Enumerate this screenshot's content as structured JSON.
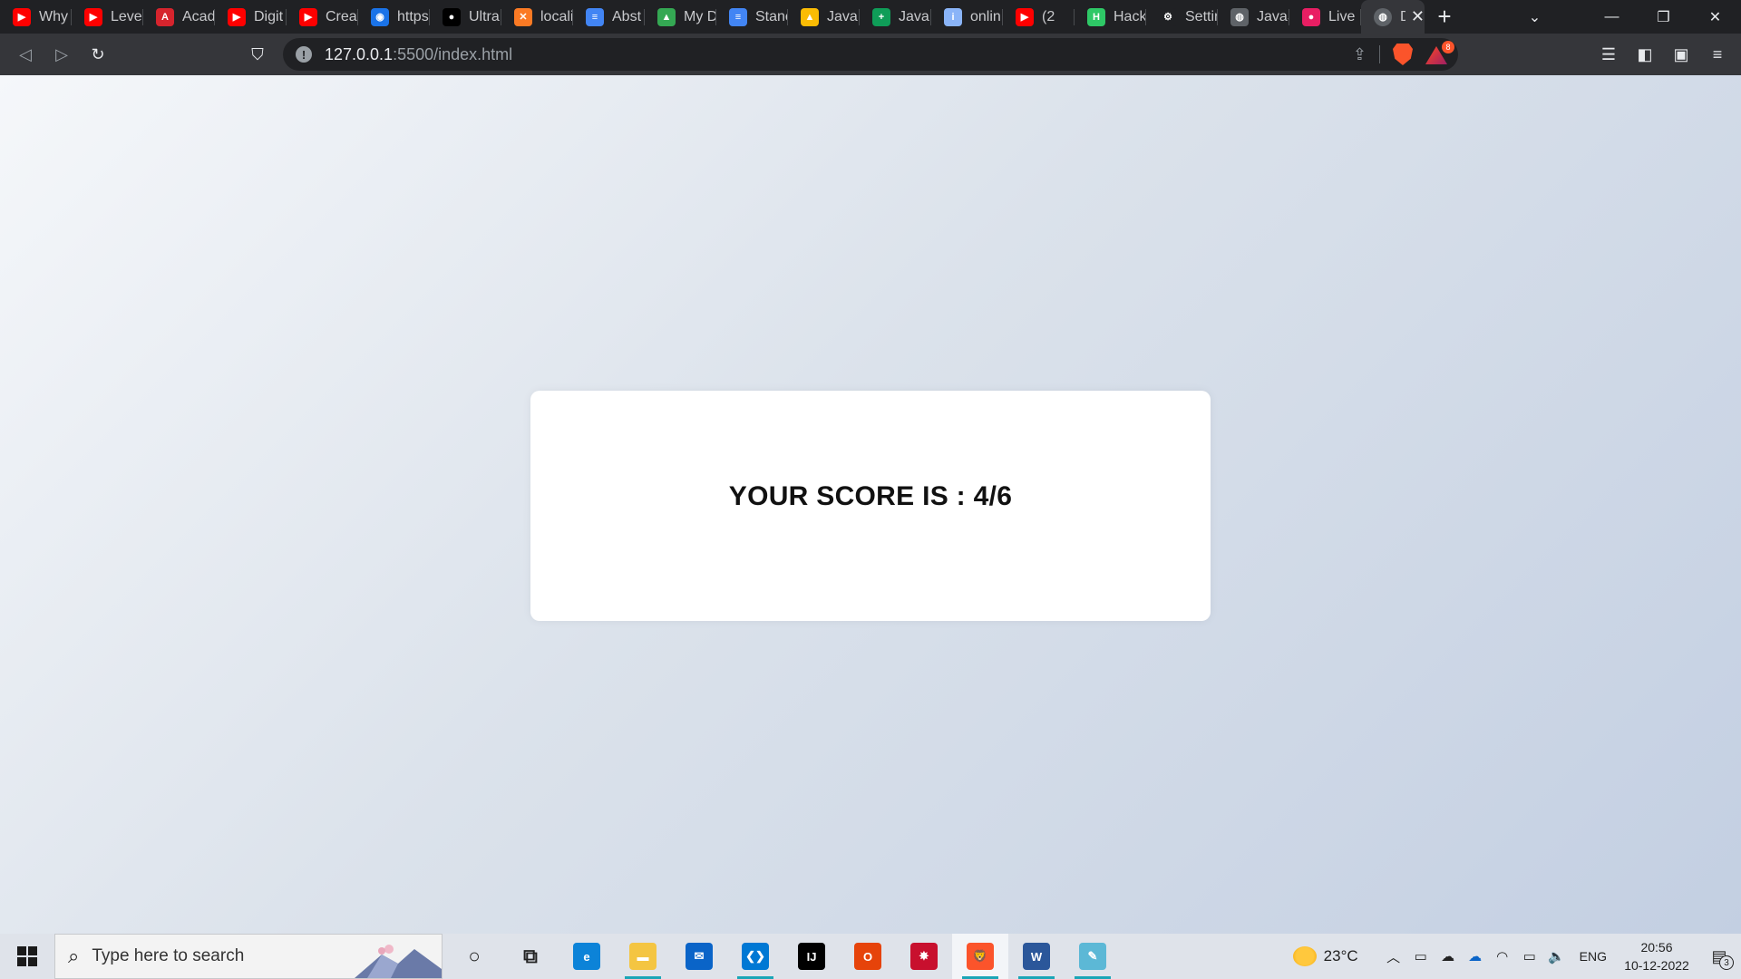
{
  "browser": {
    "tabs": [
      {
        "label": "Why",
        "icon": "youtube-icon",
        "color": "#ff0000",
        "glyph": "▶"
      },
      {
        "label": "Level",
        "icon": "youtube-icon",
        "color": "#ff0000",
        "glyph": "▶"
      },
      {
        "label": "Acad",
        "icon": "academy-icon",
        "color": "#d6242d",
        "glyph": "A"
      },
      {
        "label": "Digit",
        "icon": "youtube-icon",
        "color": "#ff0000",
        "glyph": "▶"
      },
      {
        "label": "Creat",
        "icon": "youtube-icon",
        "color": "#ff0000",
        "glyph": "▶"
      },
      {
        "label": "https",
        "icon": "web-icon",
        "color": "#1a73e8",
        "glyph": "◉"
      },
      {
        "label": "Ultra",
        "icon": "github-icon",
        "color": "#000000",
        "glyph": "●"
      },
      {
        "label": "locali",
        "icon": "xampp-icon",
        "color": "#fb7a24",
        "glyph": "✕"
      },
      {
        "label": "Abst",
        "icon": "docs-icon",
        "color": "#4285f4",
        "glyph": "≡"
      },
      {
        "label": "My D",
        "icon": "drive-icon",
        "color": "#34a853",
        "glyph": "▲"
      },
      {
        "label": "Stanc",
        "icon": "docs-icon",
        "color": "#4285f4",
        "glyph": "≡"
      },
      {
        "label": "Java",
        "icon": "drive-icon",
        "color": "#fbbc04",
        "glyph": "▲"
      },
      {
        "label": "Java",
        "icon": "sheets-icon",
        "color": "#0f9d58",
        "glyph": "+"
      },
      {
        "label": "onlin",
        "icon": "info-icon",
        "color": "#8ab4f8",
        "glyph": "i"
      },
      {
        "label": "(2",
        "icon": "youtube-icon",
        "color": "#ff0000",
        "glyph": "▶"
      },
      {
        "label": "Hack",
        "icon": "hackerrank-icon",
        "color": "#2ec866",
        "glyph": "H"
      },
      {
        "label": "Settir",
        "icon": "settings-icon",
        "color": "#202124",
        "glyph": "⚙"
      },
      {
        "label": "JavaS",
        "icon": "globe-icon",
        "color": "#5f6368",
        "glyph": "◍"
      },
      {
        "label": "Live",
        "icon": "live-icon",
        "color": "#e91e63",
        "glyph": "●"
      }
    ],
    "active_tab": {
      "label": "D",
      "icon": "globe-icon",
      "close": "✕"
    },
    "new_tab": "+",
    "url_host": "127.0.0.1",
    "url_path": ":5500/index.html",
    "shield_count": "8"
  },
  "page": {
    "score_text": "YOUR SCORE IS : 4/6"
  },
  "taskbar": {
    "search_placeholder": "Type here to search",
    "temperature": "23°C",
    "language": "ENG",
    "time": "20:56",
    "date": "10-12-2022",
    "notification_count": "3",
    "apps": [
      {
        "name": "cortana-icon",
        "glyph": "○",
        "color": "#222222"
      },
      {
        "name": "task-view-icon",
        "glyph": "⧉",
        "color": "#222222"
      },
      {
        "name": "edge-icon",
        "glyph": "e",
        "color": "#0c83d8"
      },
      {
        "name": "file-explorer-icon",
        "glyph": "▬",
        "color": "#f4c542"
      },
      {
        "name": "mail-icon",
        "glyph": "✉",
        "color": "#0a64c8"
      },
      {
        "name": "vscode-icon",
        "glyph": "❮❯",
        "color": "#0078d4"
      },
      {
        "name": "intellij-icon",
        "glyph": "IJ",
        "color": "#000000"
      },
      {
        "name": "office-icon",
        "glyph": "O",
        "color": "#e6430a"
      },
      {
        "name": "antivirus-icon",
        "glyph": "✸",
        "color": "#c8102e"
      },
      {
        "name": "brave-icon",
        "glyph": "🦁",
        "color": "#fb542b"
      },
      {
        "name": "word-icon",
        "glyph": "W",
        "color": "#2b579a"
      },
      {
        "name": "notepad-icon",
        "glyph": "✎",
        "color": "#5cb8d6"
      }
    ]
  },
  "colors": {
    "page_gradient_start": "#f5f7fa",
    "page_gradient_end": "#c3cfe2",
    "card_background": "#ffffff",
    "browser_frame": "#202124",
    "toolbar": "#35363a"
  }
}
